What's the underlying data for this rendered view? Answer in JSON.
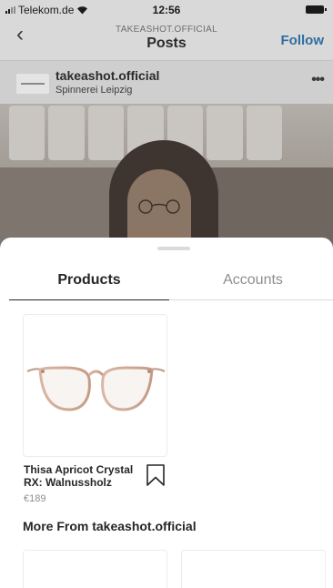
{
  "status_bar": {
    "carrier": "Telekom.de",
    "time": "12:56"
  },
  "nav": {
    "back_icon": "chevron-left-icon",
    "subtitle": "TAKEASHOT.OFFICIAL",
    "title": "Posts",
    "follow_label": "Follow"
  },
  "post": {
    "account": "takeashot.official",
    "location": "Spinnerei Leipzig",
    "more_icon": "ellipsis-icon"
  },
  "sheet": {
    "tabs": [
      {
        "label": "Products",
        "selected": true
      },
      {
        "label": "Accounts",
        "selected": false
      }
    ],
    "product": {
      "name": "Thisa Apricot Crystal RX: Walnussholz",
      "price": "€189",
      "image_icon": "eyeglasses-icon",
      "save_icon": "bookmark-icon"
    },
    "more_title": "More From takeashot.official"
  },
  "colors": {
    "link": "#2f6ea3",
    "text": "#262626",
    "muted": "#8e8e8e",
    "divider": "#dbdbdb"
  }
}
